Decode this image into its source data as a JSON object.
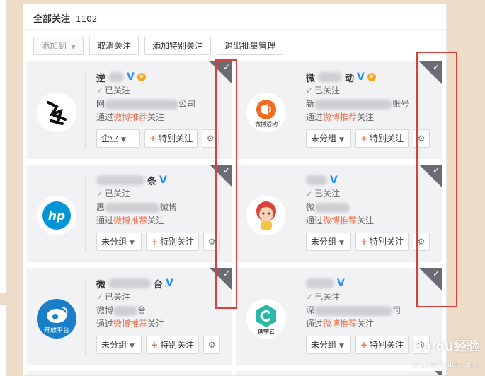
{
  "header": {
    "title": "全部关注",
    "count": "1102"
  },
  "toolbar": {
    "add_to": "添加到",
    "unfollow": "取消关注",
    "add_special": "添加特别关注",
    "exit_batch": "退出批量管理"
  },
  "cards": [
    {
      "name": "逆",
      "followed": "已关注",
      "desc_prefix": "网",
      "desc_suffix": "公司",
      "via_prefix": "通过",
      "via_link": "微博推荐",
      "via_suffix": "关注",
      "group": "企业",
      "special": "特别关注",
      "avatar_text": "逆水寒"
    },
    {
      "name": "微",
      "name_suffix": "动",
      "followed": "已关注",
      "desc_prefix": "新",
      "desc_suffix": "账号",
      "via_prefix": "通过",
      "via_link": "微博推荐",
      "via_suffix": "关注",
      "group": "未分组",
      "special": "特别关注",
      "avatar_text": "微博活动"
    },
    {
      "name": "",
      "name_suffix": "条",
      "followed": "已关注",
      "desc_prefix": "惠",
      "desc_suffix": "微博",
      "via_prefix": "通过",
      "via_link": "微博推荐",
      "via_suffix": "关注",
      "group": "未分组",
      "special": "特别关注",
      "avatar_text": "hp"
    },
    {
      "name": "",
      "followed": "已关注",
      "desc_prefix": "微",
      "desc_suffix": "",
      "via_prefix": "通过",
      "via_link": "微博推荐",
      "via_suffix": "关注",
      "group": "未分组",
      "special": "特别关注",
      "avatar_text": ""
    },
    {
      "name": "微",
      "name_suffix": "台",
      "followed": "已关注",
      "desc_prefix": "微博",
      "desc_suffix": "台",
      "via_prefix": "通过",
      "via_link": "微博推荐",
      "via_suffix": "关注",
      "group": "未分组",
      "special": "特别关注",
      "avatar_text": "开放平台"
    },
    {
      "name": "",
      "followed": "已关注",
      "desc_prefix": "深",
      "desc_suffix": "司",
      "via_prefix": "通过",
      "via_link": "微博推荐",
      "via_suffix": "关注",
      "group": "未分组",
      "special": "特别关注",
      "avatar_text": "创宇云"
    }
  ],
  "watermark": {
    "main": "Baidu经验",
    "sub": "jingyan.baidu.com"
  },
  "colors": {
    "accent": "#eb7350",
    "verified": "#1e90ff",
    "highlight": "#d9403a",
    "corner": "#6b6b73"
  }
}
